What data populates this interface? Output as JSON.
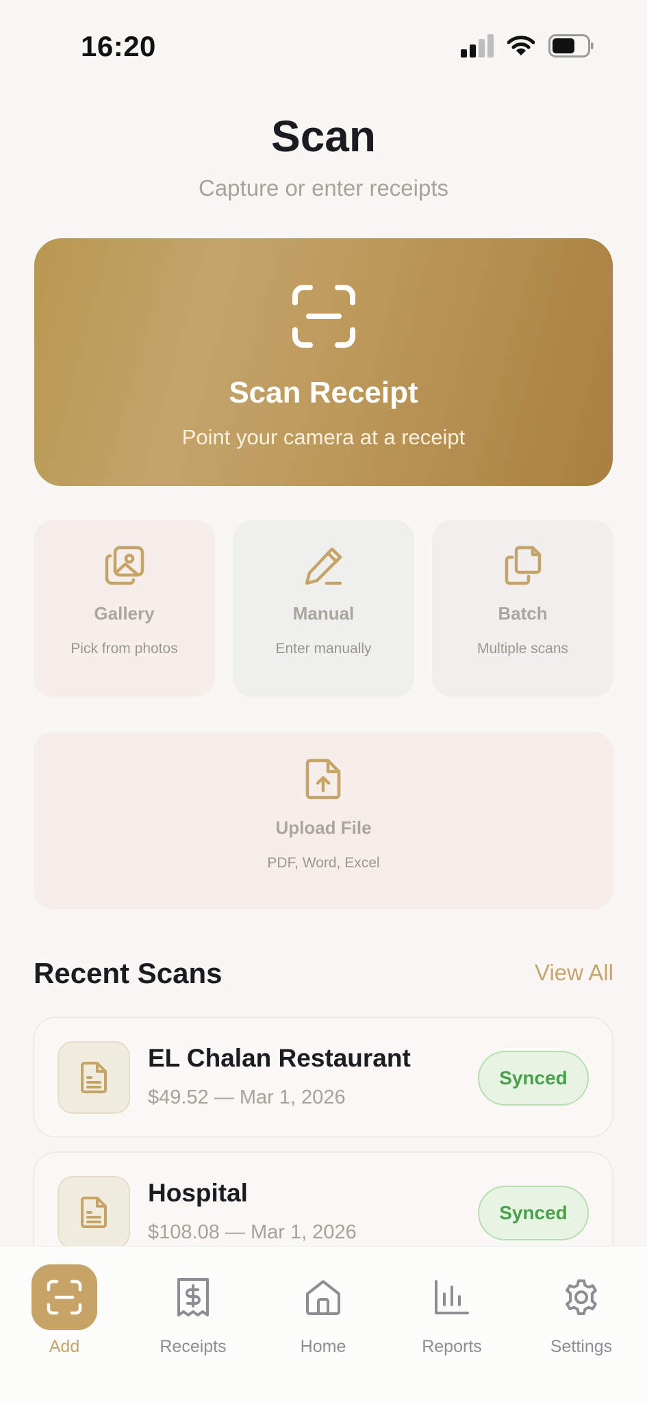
{
  "status_bar": {
    "time": "16:20"
  },
  "header": {
    "title": "Scan",
    "subtitle": "Capture or enter receipts"
  },
  "scan_card": {
    "title": "Scan Receipt",
    "subtitle": "Point your camera at a receipt",
    "icon": "scan-frame-icon"
  },
  "options": [
    {
      "title": "Gallery",
      "subtitle": "Pick from photos",
      "icon": "gallery-icon",
      "bg": "#f6eeea"
    },
    {
      "title": "Manual",
      "subtitle": "Enter manually",
      "icon": "pencil-icon",
      "bg": "#eff0ed"
    },
    {
      "title": "Batch",
      "subtitle": "Multiple scans",
      "icon": "copy-icon",
      "bg": "#f0efed"
    }
  ],
  "upload": {
    "title": "Upload File",
    "subtitle": "PDF, Word, Excel",
    "icon": "file-upload-icon"
  },
  "recent": {
    "title": "Recent Scans",
    "view_all": "View All",
    "items": [
      {
        "name": "EL Chalan Restaurant",
        "meta": "$49.52 — Mar 1, 2026",
        "status": "Synced"
      },
      {
        "name": "Hospital",
        "meta": "$108.08 — Mar 1, 2026",
        "status": "Synced"
      }
    ]
  },
  "tabs": [
    {
      "label": "Add",
      "icon": "scan-frame-icon",
      "active": true
    },
    {
      "label": "Receipts",
      "icon": "receipt-icon",
      "active": false
    },
    {
      "label": "Home",
      "icon": "home-icon",
      "active": false
    },
    {
      "label": "Reports",
      "icon": "bar-chart-icon",
      "active": false
    },
    {
      "label": "Settings",
      "icon": "gear-icon",
      "active": false
    }
  ],
  "colors": {
    "accent": "#c6a468",
    "background": "#f8f7f4",
    "synced_text": "#49a04a",
    "synced_bg": "#e7f3e3"
  }
}
